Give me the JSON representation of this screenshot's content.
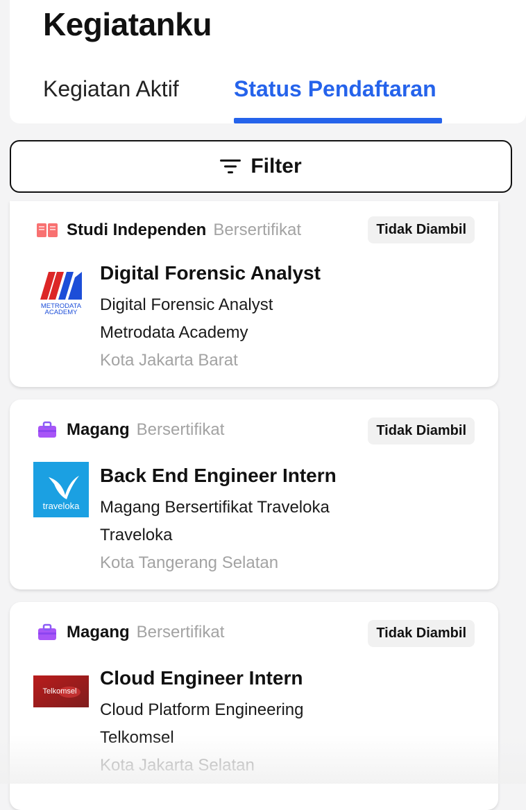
{
  "page": {
    "title": "Kegiatanku"
  },
  "tabs": [
    {
      "label": "Kegiatan Aktif",
      "active": false
    },
    {
      "label": "Status Pendaftaran",
      "active": true
    }
  ],
  "filter": {
    "label": "Filter",
    "icon": "filter-icon"
  },
  "accent_color": "#2563eb",
  "cards": [
    {
      "category": "Studi Independen",
      "category_sub": "Bersertifikat",
      "category_icon": "book-icon",
      "status": "Tidak Diambil",
      "logo": {
        "name": "metrodata-academy-logo",
        "text_line1": "METRODATA",
        "text_line2": "ACADEMY"
      },
      "title": "Digital Forensic Analyst",
      "program": "Digital Forensic Analyst",
      "company": "Metrodata Academy",
      "location": "Kota Jakarta Barat"
    },
    {
      "category": "Magang",
      "category_sub": "Bersertifikat",
      "category_icon": "briefcase-icon",
      "status": "Tidak Diambil",
      "logo": {
        "name": "traveloka-logo",
        "text": "traveloka"
      },
      "title": "Back End Engineer Intern",
      "program": "Magang Bersertifikat Traveloka",
      "company": "Traveloka",
      "location": "Kota Tangerang Selatan"
    },
    {
      "category": "Magang",
      "category_sub": "Bersertifikat",
      "category_icon": "briefcase-icon",
      "status": "Tidak Diambil",
      "logo": {
        "name": "telkomsel-logo",
        "text": "Telkomsel"
      },
      "title": "Cloud Engineer Intern",
      "program": "Cloud Platform Engineering",
      "company": "Telkomsel",
      "location": "Kota Jakarta Selatan"
    }
  ]
}
